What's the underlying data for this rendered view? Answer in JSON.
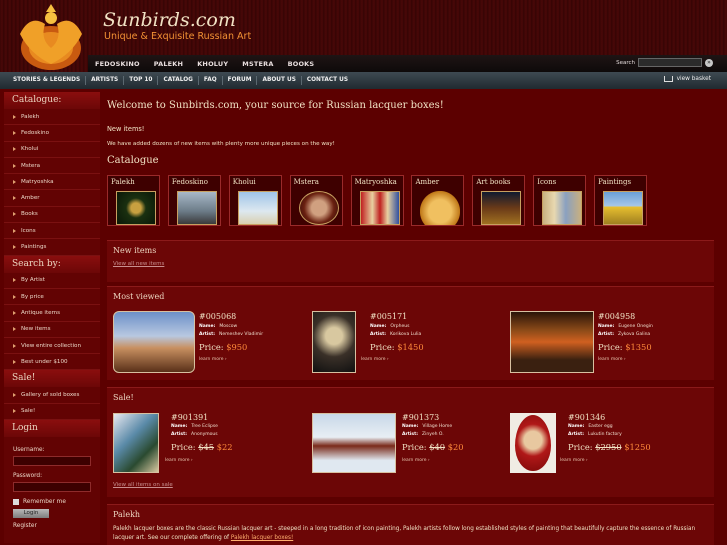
{
  "header": {
    "brand": "Sunbirds.com",
    "tagline": "Unique & Exquisite Russian Art",
    "topnav": [
      "FEDOSKINO",
      "PALEKH",
      "KHOLUY",
      "MSTERA",
      "BOOKS"
    ],
    "search_label": "Search"
  },
  "subnav": {
    "items": [
      "STORIES & LEGENDS",
      "ARTISTS",
      "TOP 10",
      "CATALOG",
      "FAQ",
      "FORUM",
      "ABOUT US",
      "CONTACT US"
    ],
    "basket": "view basket"
  },
  "sidebar": {
    "catalogue_title": "Catalogue:",
    "catalogue": [
      "Palekh",
      "Fedoskino",
      "Kholui",
      "Mstera",
      "Matryoshka",
      "Amber",
      "Books",
      "Icons",
      "Paintings"
    ],
    "searchby_title": "Search by:",
    "searchby": [
      "By Artist",
      "By price",
      "Antique items",
      "New items",
      "View entire collection",
      "Best under $100"
    ],
    "sale_title": "Sale!",
    "sale": [
      "Gallery of sold boxes",
      "Sale!"
    ],
    "login_title": "Login",
    "username_label": "Username:",
    "password_label": "Password:",
    "remember_label": "Remember me",
    "login_button": "Login",
    "register_label": "Register"
  },
  "main": {
    "welcome": "Welcome to Sunbirds.com, your source for Russian lacquer boxes!",
    "new_items_heading": "New items!",
    "new_items_text": "We have added dozens of new items with plenty more unique pieces on the way!",
    "catalogue_title": "Catalogue",
    "categories": [
      "Palekh",
      "Fedoskino",
      "Kholui",
      "Mstera",
      "Matryoshka",
      "Amber",
      "Art books",
      "Icons",
      "Paintings"
    ],
    "new_items_panel": {
      "title": "New items",
      "link": "View all new items"
    },
    "most_viewed": {
      "title": "Most viewed",
      "more": "learn more",
      "items": [
        {
          "num": "#005068",
          "name": "Moscow",
          "artist": "Nemeshev Vladimir",
          "price_label": "Price:",
          "price": "$950"
        },
        {
          "num": "#005171",
          "name": "Orpheus",
          "artist": "Korikova Lulia",
          "price_label": "Price:",
          "price": "$1450"
        },
        {
          "num": "#004958",
          "name": "Eugene Onegin",
          "artist": "Zykova Galina",
          "price_label": "Price:",
          "price": "$1350"
        }
      ]
    },
    "sale": {
      "title": "Sale!",
      "more": "learn more",
      "link": "View all items on sale",
      "items": [
        {
          "num": "#901391",
          "name": "Tree Eclipse",
          "artist": "Anonymous",
          "price_label": "Price:",
          "old": "$45",
          "price": "$22"
        },
        {
          "num": "#901373",
          "name": "Village Home",
          "artist": "Zinyeh O.",
          "price_label": "Price:",
          "old": "$40",
          "price": "$20"
        },
        {
          "num": "#901346",
          "name": "Easter egg",
          "artist": "Lukutin factory",
          "price_label": "Price:",
          "old": "$2950",
          "price": "$1250"
        }
      ]
    },
    "palekh": {
      "title": "Palekh",
      "text": "Palekh lacquer boxes are the classic Russian lacquer art - steeped in a long tradition of icon painting, Palekh artists follow long established styles of painting that beautifully capture the essence of Russian lacquer art. See our complete offering of",
      "link": "Palekh lacquer boxes!"
    }
  },
  "labels": {
    "name": "Name:",
    "artist": "Artist:"
  }
}
